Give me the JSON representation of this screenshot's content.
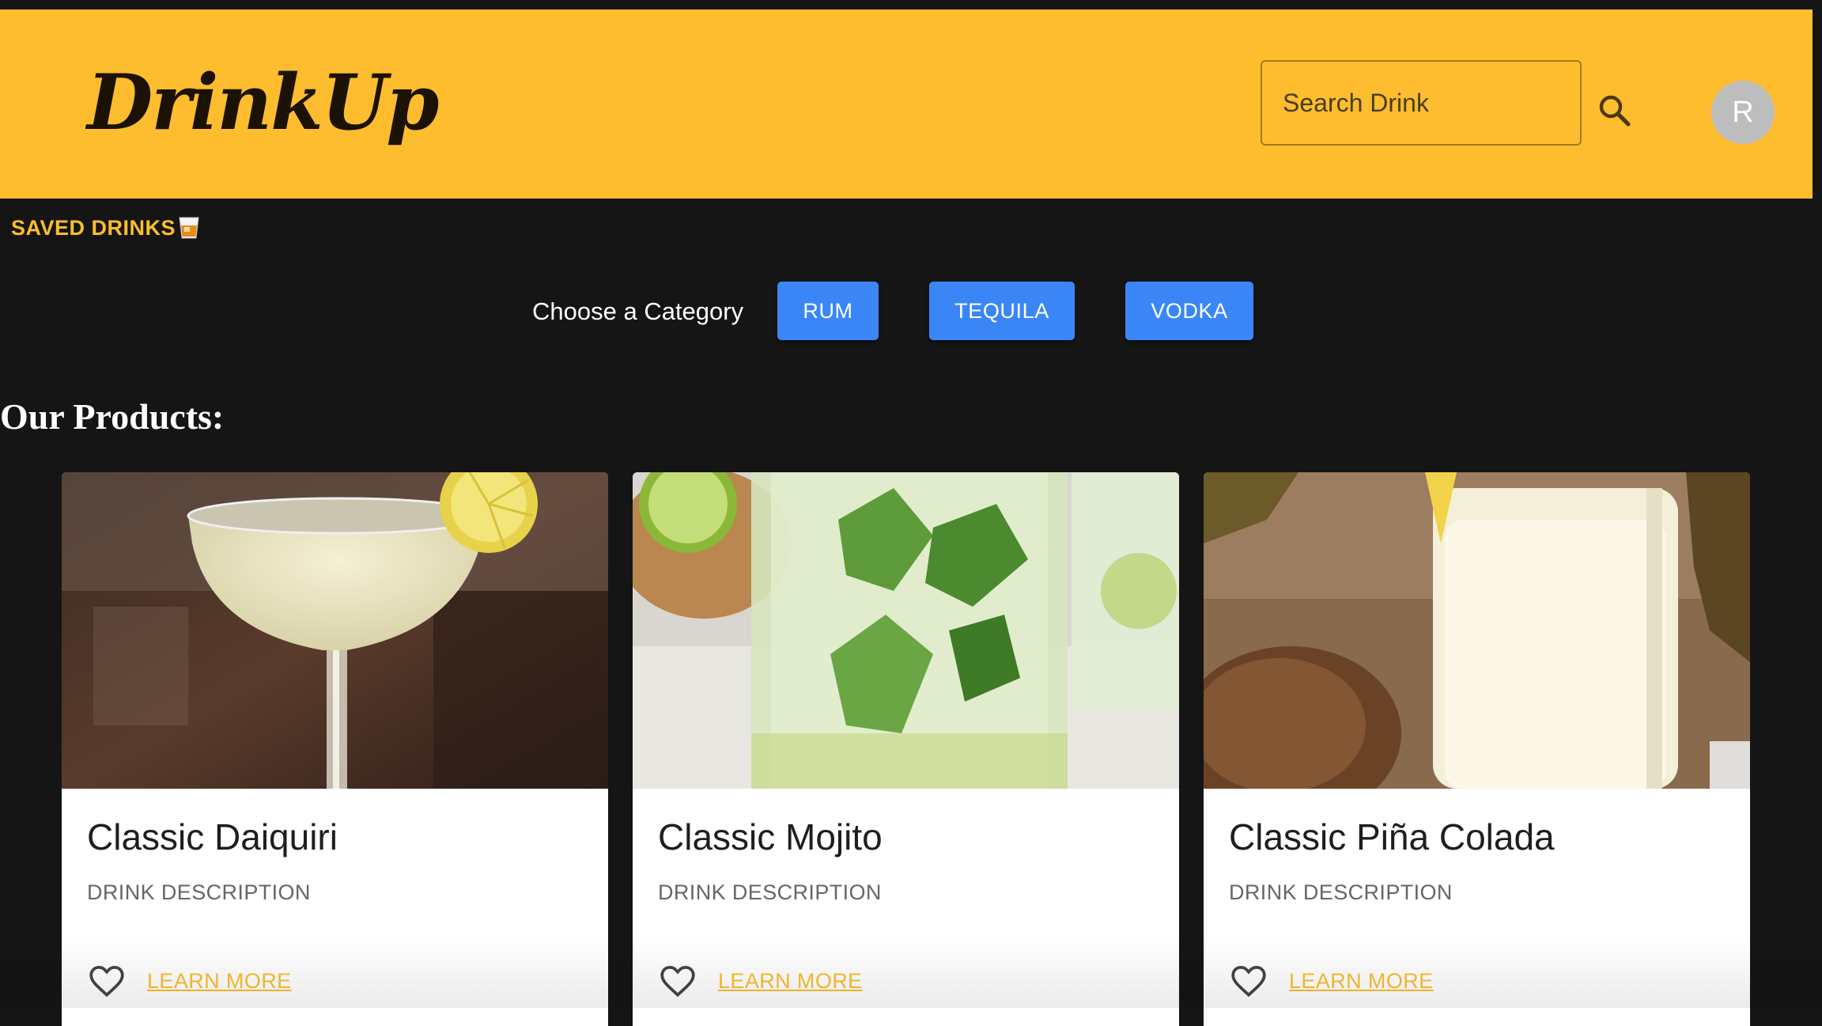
{
  "header": {
    "logo": "DrinkUp",
    "search_placeholder": "Search Drink",
    "search_icon": "search-icon",
    "avatar_letter": "R"
  },
  "saved": {
    "label": "SAVED DRINKS",
    "icon": "tumbler-glass-icon"
  },
  "categories": {
    "label": "Choose a Category",
    "buttons": [
      "RUM",
      "TEQUILA",
      "VODKA"
    ]
  },
  "products": {
    "title": "Our Products:",
    "items": [
      {
        "name": "Classic Daiquiri",
        "description": "DRINK DESCRIPTION",
        "action": "LEARN MORE",
        "image": "daiquiri-image"
      },
      {
        "name": "Classic Mojito",
        "description": "DRINK DESCRIPTION",
        "action": "LEARN MORE",
        "image": "mojito-image"
      },
      {
        "name": "Classic Piña Colada",
        "description": "DRINK DESCRIPTION",
        "action": "LEARN MORE",
        "image": "pina-colada-image"
      }
    ]
  },
  "colors": {
    "header_bg": "#fdbd2f",
    "page_bg": "#151515",
    "button_blue": "#3b86f7",
    "link_yellow": "#fdbd2f"
  }
}
